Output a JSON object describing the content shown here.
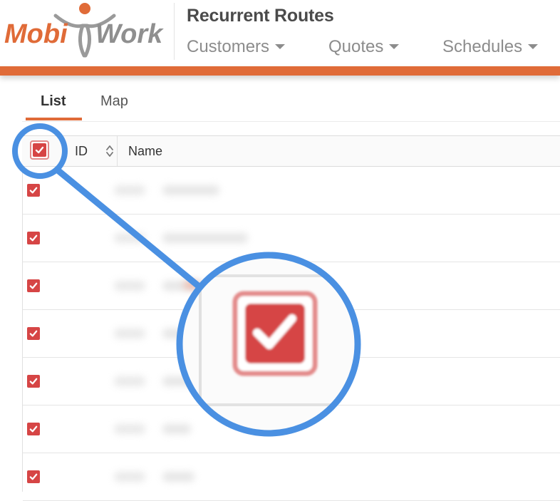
{
  "brand": {
    "left_text": "Mobi",
    "right_text": "Work",
    "accent_color": "#e06b38",
    "text_color": "#e06b38"
  },
  "header": {
    "title": "Recurrent Routes",
    "nav": [
      {
        "label": "Customers",
        "icon": "caret-down-icon"
      },
      {
        "label": "Quotes",
        "icon": "caret-down-icon"
      },
      {
        "label": "Schedules",
        "icon": "caret-down-icon"
      }
    ]
  },
  "tabs": [
    {
      "label": "List",
      "active": true
    },
    {
      "label": "Map",
      "active": false
    }
  ],
  "table": {
    "columns": [
      {
        "label": "",
        "icon": "checkbox-icon",
        "checked": true
      },
      {
        "label": "ID",
        "icon": "sort-icon"
      },
      {
        "label": "Name"
      }
    ],
    "rows": [
      {
        "checked": true
      },
      {
        "checked": true
      },
      {
        "checked": true
      },
      {
        "checked": true
      },
      {
        "checked": true
      },
      {
        "checked": true
      },
      {
        "checked": true
      }
    ]
  },
  "colors": {
    "checkbox": "#d64545",
    "callout": "#4a90e2"
  }
}
